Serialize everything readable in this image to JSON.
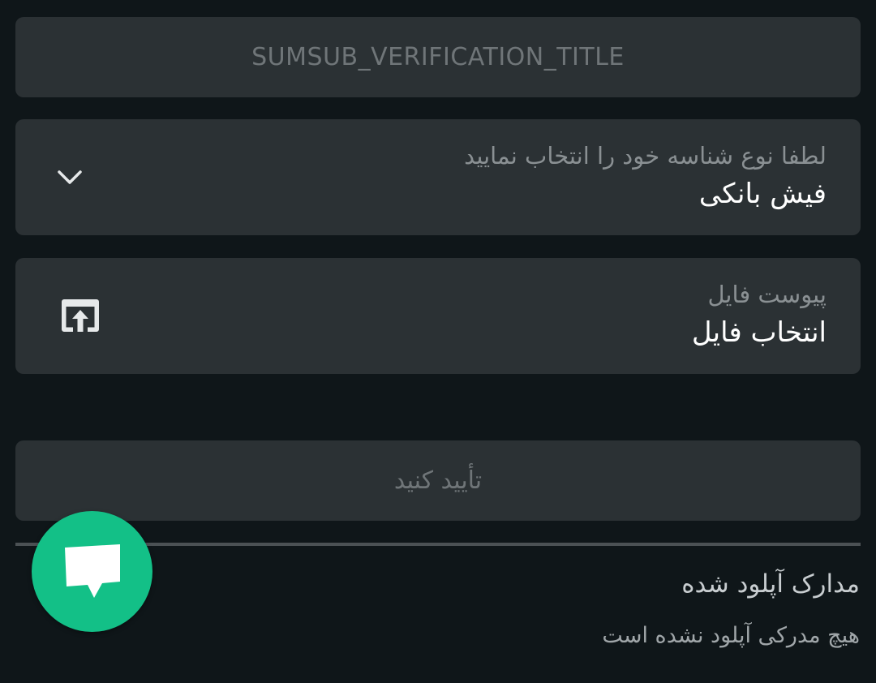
{
  "sumsub": {
    "label": "SUMSUB_VERIFICATION_TITLE"
  },
  "id_type": {
    "label": "لطفا نوع شناسه خود را انتخاب نمایید",
    "value": "فیش بانکی",
    "icon": "chevron-down-icon"
  },
  "attachment": {
    "label": "پیوست فایل",
    "value": "انتخاب فایل",
    "icon": "upload-icon"
  },
  "confirm": {
    "label": "تأیید کنید"
  },
  "uploaded": {
    "title": "مدارک آپلود شده",
    "empty_text": "هیچ مدرکی آپلود نشده است"
  },
  "chat": {
    "icon": "chat-bubble-icon",
    "color": "#13c087"
  },
  "colors": {
    "background": "#0f1619",
    "card": "#2b3134",
    "accent": "#13c087"
  }
}
